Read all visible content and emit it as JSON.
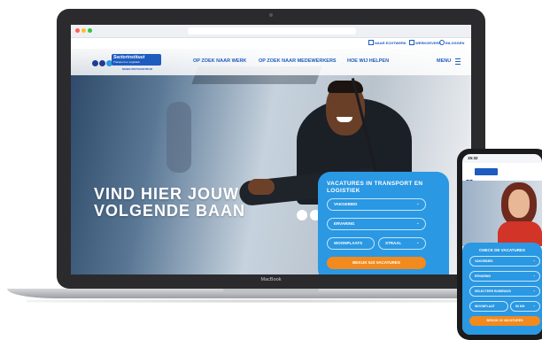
{
  "laptop": {
    "brand_label": "MacBook"
  },
  "site": {
    "top_links": [
      {
        "label": "NAAR ECHTWERK",
        "icon": "external-link-icon"
      },
      {
        "label": "WERKGEVERS",
        "icon": "briefcase-icon"
      },
      {
        "label": "INLOGGEN",
        "icon": "user-icon"
      }
    ],
    "logo": {
      "name": "Sectorinstituut",
      "tagline": "Transport en Logistiek",
      "subline": "MOBILITEITSCENTRUM"
    },
    "nav": {
      "items": [
        "OP ZOEK NAAR WERK",
        "OP ZOEK NAAR MEDEWERKERS",
        "HOE WIJ HELPEN"
      ],
      "menu_label": "MENU"
    },
    "hero": {
      "title_line1": "VIND HIER JOUW",
      "title_line2": "VOLGENDE BAAN"
    },
    "search_card": {
      "title": "VACATURES IN TRANSPORT EN LOGISTIEK",
      "fields": {
        "vakgebied": "VAKGEBIED",
        "ervaring": "ERVARING",
        "woonplaats": "WOONPLAATS",
        "straal": "STRAAL"
      },
      "button_label": "BEKIJK 523 VACATURES"
    }
  },
  "phone": {
    "time": "15:32",
    "search_card": {
      "title": "CHECK DE VACATURES",
      "fields": {
        "vakgebied": "VAKGEBIED",
        "ervaring": "ERVARING",
        "rijbewijs": "SELECTEER RIJBEWIJS",
        "woonplaats": "WOONPLAAT",
        "straal": "50 KM"
      },
      "button_label": "BEKIJK 16 VACATURES"
    }
  },
  "colors": {
    "brand_blue": "#1d5bbf",
    "card_blue": "#2a98e3",
    "accent_orange": "#f28a1e"
  }
}
